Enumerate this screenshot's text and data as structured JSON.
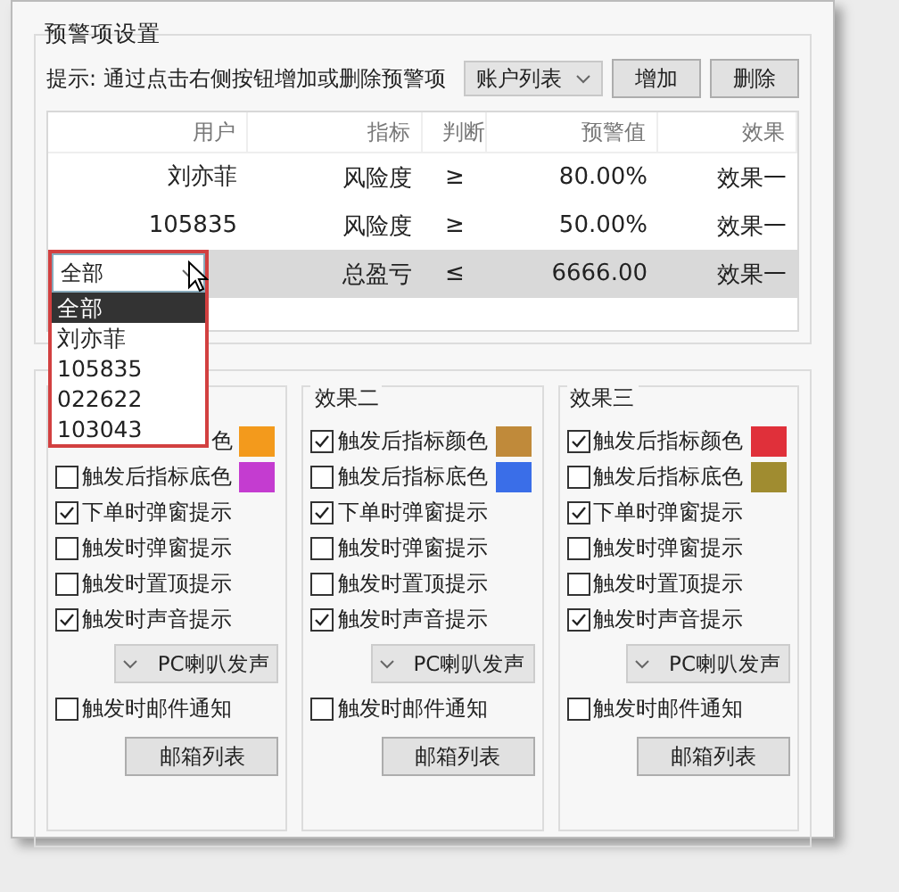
{
  "group_title": "预警项设置",
  "hint": "提示: 通过点击右侧按钮增加或删除预警项",
  "account_select": {
    "value": "账户列表"
  },
  "buttons": [
    "增加",
    "删除"
  ],
  "table": {
    "columns": [
      "用户",
      "指标",
      "判断",
      "预警值",
      "效果"
    ],
    "rows": [
      {
        "cells": [
          "刘亦菲",
          "风险度",
          "≥",
          "80.00%",
          "效果一"
        ],
        "selected": false
      },
      {
        "cells": [
          "105835",
          "风险度",
          "≥",
          "50.00%",
          "效果一"
        ],
        "selected": false
      },
      {
        "user_dropdown": {
          "value": "全部",
          "options": [
            {
              "label": "全部",
              "selected": true
            },
            {
              "label": "刘亦菲",
              "selected": false
            },
            {
              "label": "105835",
              "selected": false
            },
            {
              "label": "022622",
              "selected": false
            },
            {
              "label": "103043",
              "selected": false
            }
          ]
        },
        "cells": [
          "",
          "总盈亏",
          "≤",
          "6666.00",
          "效果一"
        ],
        "selected": true
      }
    ]
  },
  "effects": [
    {
      "items": [
        {
          "kind": "partial",
          "label": "色",
          "color": "#f39a1c"
        },
        {
          "kind": "check",
          "label": "触发后指标底色",
          "checked": false,
          "color": "#c43cd0"
        },
        {
          "kind": "check",
          "label": "下单时弹窗提示",
          "checked": true
        },
        {
          "kind": "check",
          "label": "触发时弹窗提示",
          "checked": false
        },
        {
          "kind": "check",
          "label": "触发时置顶提示",
          "checked": false
        },
        {
          "kind": "check",
          "label": "触发时声音提示",
          "checked": true
        },
        {
          "kind": "select",
          "label": "PC喇叭发声"
        },
        {
          "kind": "check",
          "label": "触发时邮件通知",
          "checked": false
        },
        {
          "kind": "button",
          "label": "邮箱列表"
        }
      ]
    },
    {
      "title": "效果二",
      "items": [
        {
          "kind": "check",
          "label": "触发后指标颜色",
          "checked": true,
          "color": "#c08a3a"
        },
        {
          "kind": "check",
          "label": "触发后指标底色",
          "checked": false,
          "color": "#3a6ee8"
        },
        {
          "kind": "check",
          "label": "下单时弹窗提示",
          "checked": true
        },
        {
          "kind": "check",
          "label": "触发时弹窗提示",
          "checked": false
        },
        {
          "kind": "check",
          "label": "触发时置顶提示",
          "checked": false
        },
        {
          "kind": "check",
          "label": "触发时声音提示",
          "checked": true
        },
        {
          "kind": "select",
          "label": "PC喇叭发声"
        },
        {
          "kind": "check",
          "label": "触发时邮件通知",
          "checked": false
        },
        {
          "kind": "button",
          "label": "邮箱列表"
        }
      ]
    },
    {
      "title": "效果三",
      "items": [
        {
          "kind": "check",
          "label": "触发后指标颜色",
          "checked": true,
          "color": "#e0303a"
        },
        {
          "kind": "check",
          "label": "触发后指标底色",
          "checked": false,
          "color": "#a08c30"
        },
        {
          "kind": "check",
          "label": "下单时弹窗提示",
          "checked": true
        },
        {
          "kind": "check",
          "label": "触发时弹窗提示",
          "checked": false
        },
        {
          "kind": "check",
          "label": "触发时置顶提示",
          "checked": false
        },
        {
          "kind": "check",
          "label": "触发时声音提示",
          "checked": true
        },
        {
          "kind": "select",
          "label": "PC喇叭发声"
        },
        {
          "kind": "check",
          "label": "触发时邮件通知",
          "checked": false
        },
        {
          "kind": "button",
          "label": "邮箱列表"
        }
      ]
    }
  ]
}
